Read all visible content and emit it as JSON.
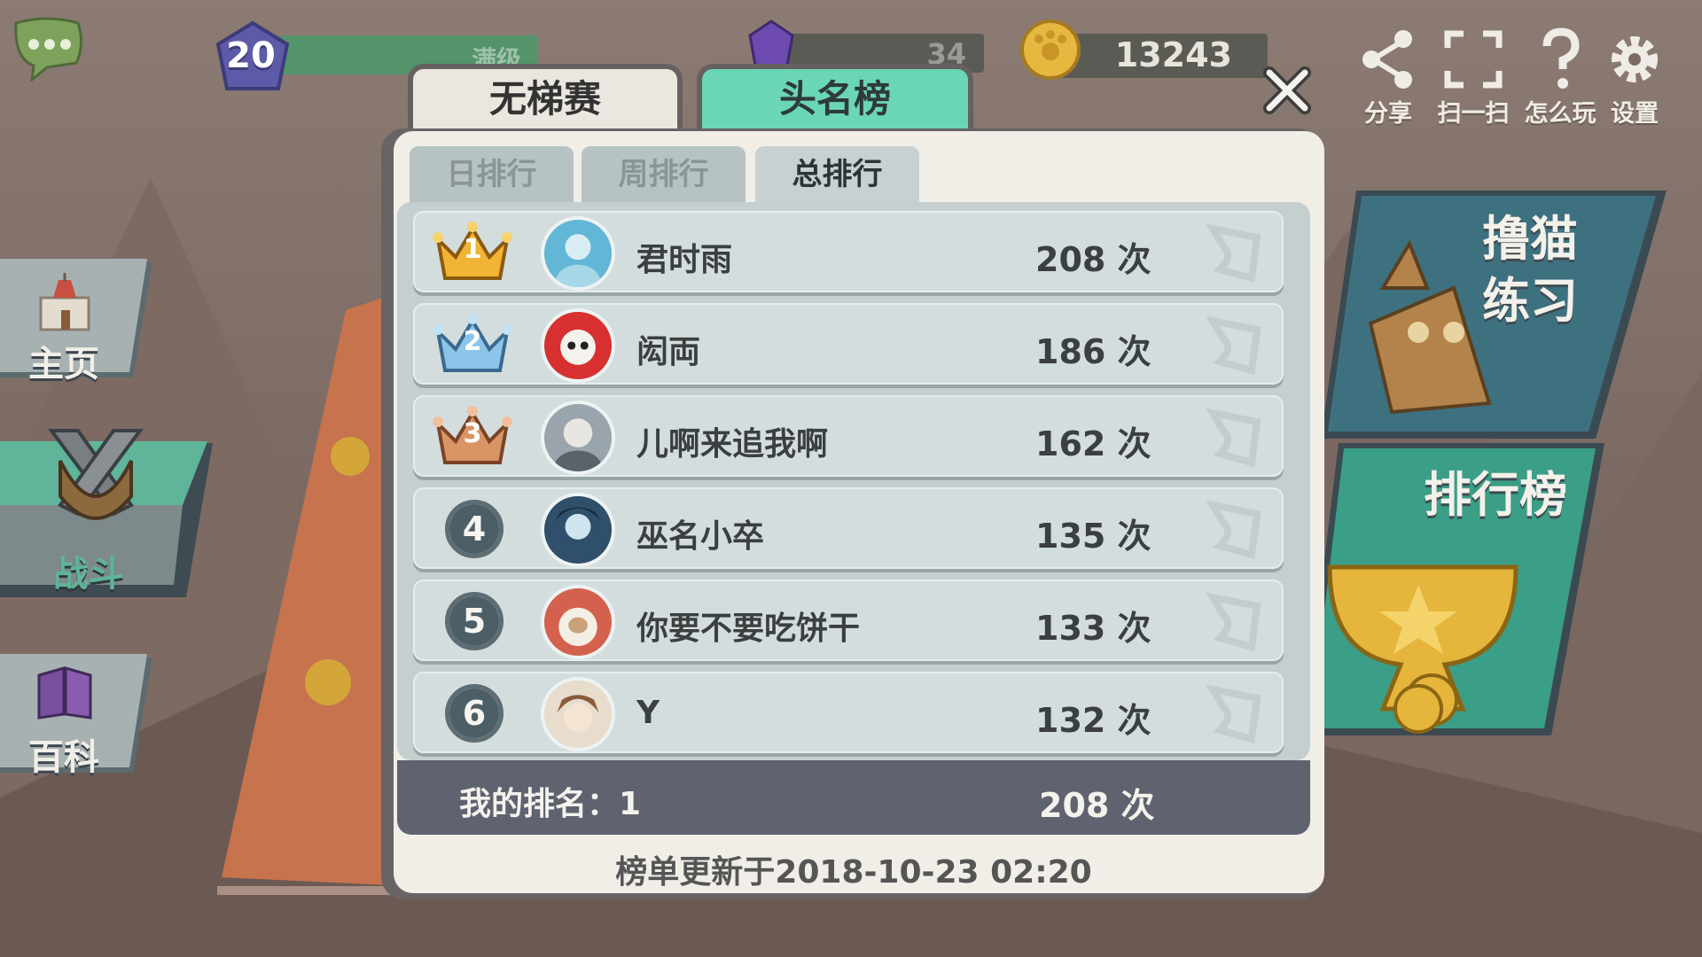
{
  "colors": {
    "accent_tab": "#6bd6b6",
    "modal_frame": "#686364",
    "row_bg": "#d4dddd",
    "my_rank_bg": "#5e636f",
    "battle_highlight": "#5fb49a"
  },
  "top_bar": {
    "level": "20",
    "level_status": "满级",
    "level_progress": 1.0,
    "gems": "34",
    "coins": "13243",
    "icons": [
      {
        "icon": "share-icon",
        "label": "分享"
      },
      {
        "icon": "scan-icon",
        "label": "扫一扫"
      },
      {
        "icon": "question-icon",
        "label": "怎么玩"
      },
      {
        "icon": "gear-icon",
        "label": "设置"
      }
    ]
  },
  "nav": {
    "home": "主页",
    "battle": "战斗",
    "wiki": "百科"
  },
  "cards": {
    "practice": "撸猫\n练习",
    "leaderboard": "排行榜"
  },
  "modal": {
    "mode_tabs": [
      "无梯赛",
      "头名榜"
    ],
    "active_mode": "头名榜",
    "period_tabs": [
      "日排行",
      "周排行",
      "总排行"
    ],
    "active_period": "总排行",
    "rows": [
      {
        "rank": "1",
        "name": "君时雨",
        "score": "208 次",
        "avatar": "blue-anime-avatar"
      },
      {
        "rank": "2",
        "name": "闳両",
        "score": "186 次",
        "avatar": "red-character-avatar"
      },
      {
        "rank": "3",
        "name": "儿啊来追我啊",
        "score": "162 次",
        "avatar": "white-hair-avatar"
      },
      {
        "rank": "4",
        "name": "巫名小卒",
        "score": "135 次",
        "avatar": "dark-anime-avatar"
      },
      {
        "rank": "5",
        "name": "你要不要吃饼干",
        "score": "133 次",
        "avatar": "sheep-avatar"
      },
      {
        "rank": "6",
        "name": "Y",
        "score": "132 次",
        "avatar": "brown-hair-avatar"
      }
    ],
    "my_rank_label": "我的排名：1",
    "my_rank_score": "208 次",
    "updated": "榜单更新于2018-10-23 02:20"
  }
}
